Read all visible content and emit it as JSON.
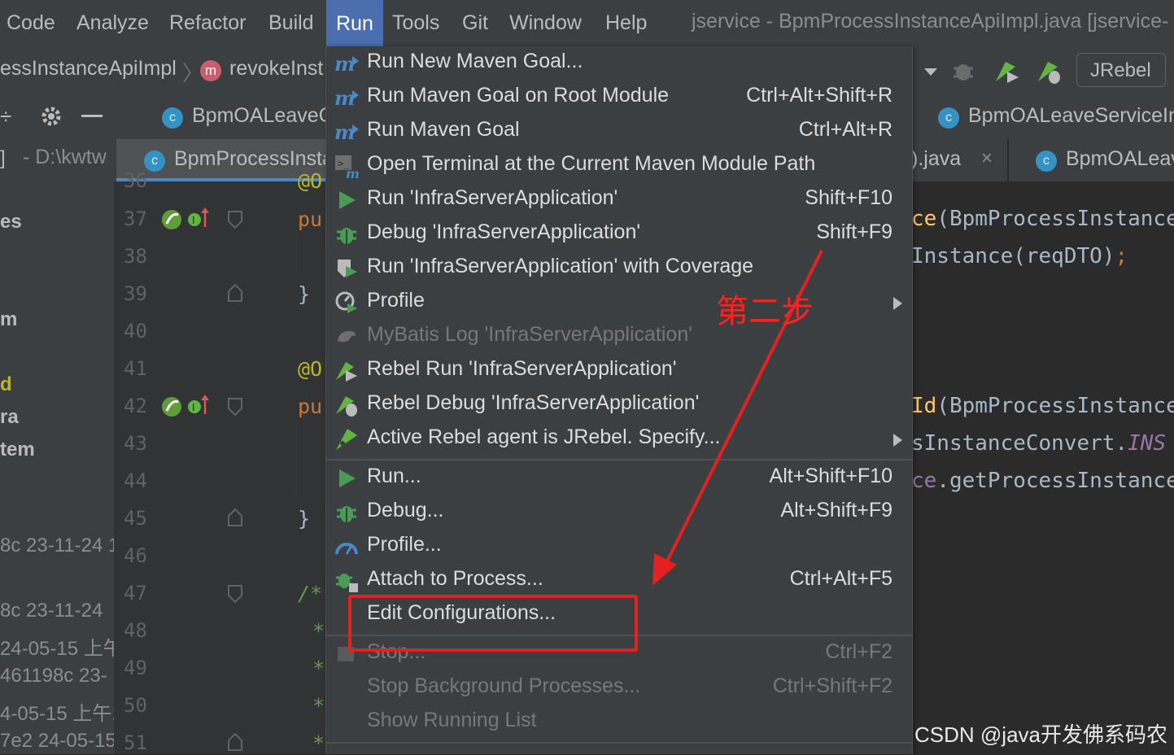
{
  "menubar": {
    "items": [
      "Code",
      "Analyze",
      "Refactor",
      "Build",
      "Run",
      "Tools",
      "Git",
      "Window",
      "Help"
    ],
    "active": "Run",
    "title": "jservice - BpmProcessInstanceApiImpl.java [jservice-"
  },
  "navbar": {
    "crumb_class": "essInstanceApiImpl",
    "crumb_method": "revokeInst",
    "method_badge": "m",
    "run_config": "JRebel"
  },
  "tabs": {
    "row1_left": "BpmOALeaveC",
    "row1_right": "BpmOALeaveServiceIn",
    "row2_path": "- D:\\kwtw",
    "row2_active": "BpmProcessInsta",
    "row2_mid": ").java",
    "row2_right": "BpmOALeav",
    "class_badge": "c"
  },
  "sidebar": {
    "lines": [
      "es",
      "m",
      "d",
      "ra",
      "tem",
      "8c 23-11-24 1",
      "8c 23-11-24",
      "24-05-15 上午",
      "461198c 23-",
      "4-05-15 上午1",
      "7e2 24-05-15"
    ]
  },
  "gutter": {
    "line_numbers": [
      "36",
      "37",
      "38",
      "39",
      "40",
      "41",
      "42",
      "43",
      "44",
      "45",
      "46",
      "47",
      "48",
      "49",
      "50",
      "51"
    ]
  },
  "code_left": {
    "l36": "@O",
    "l37": "pu",
    "l39": "}",
    "l41": "@O",
    "l42": "pu",
    "l45": "}",
    "l47": "/*",
    "l48": "*",
    "l49": "*",
    "l50": "*",
    "l51": "*"
  },
  "code_right": {
    "l37_a": "ce",
    "l37_b": "(BpmProcessInstance",
    "l38_a": "Instance(reqDTO)",
    "l38_b": ";",
    "l42_a": "Id",
    "l42_b": "(BpmProcessInstance",
    "l43_a": "sInstanceConvert.",
    "l43_b": "INS",
    "l44_a": "ce",
    "l44_b": ".getProcessInstance"
  },
  "run_menu": {
    "items": [
      {
        "label": "Run New Maven Goal...",
        "shortcut": "",
        "icon": "maven-icon"
      },
      {
        "label": "Run Maven Goal on Root Module",
        "shortcut": "Ctrl+Alt+Shift+R",
        "icon": "maven-icon"
      },
      {
        "label": "Run Maven Goal",
        "shortcut": "Ctrl+Alt+R",
        "icon": "maven-icon"
      },
      {
        "label": "Open Terminal at the Current Maven Module Path",
        "shortcut": "",
        "icon": "terminal-maven-icon"
      },
      {
        "label": "Run 'InfraServerApplication'",
        "shortcut": "Shift+F10",
        "icon": "run-icon"
      },
      {
        "label": "Debug 'InfraServerApplication'",
        "shortcut": "Shift+F9",
        "icon": "debug-icon"
      },
      {
        "label": "Run 'InfraServerApplication' with Coverage",
        "shortcut": "",
        "icon": "coverage-icon"
      },
      {
        "label": "Profile",
        "shortcut": "",
        "icon": "profile-icon"
      },
      {
        "label": "MyBatis Log 'InfraServerApplication'",
        "shortcut": "",
        "icon": "mybatis-icon"
      },
      {
        "label": "Rebel Run 'InfraServerApplication'",
        "shortcut": "",
        "icon": "rebel-run-icon"
      },
      {
        "label": "Rebel Debug 'InfraServerApplication'",
        "shortcut": "",
        "icon": "rebel-debug-icon"
      },
      {
        "label": "Active Rebel agent is JRebel. Specify...",
        "shortcut": "",
        "icon": "rebel-agent-icon"
      },
      {
        "label": "Run...",
        "shortcut": "Alt+Shift+F10",
        "icon": "run-icon"
      },
      {
        "label": "Debug...",
        "shortcut": "Alt+Shift+F9",
        "icon": "debug-icon"
      },
      {
        "label": "Profile...",
        "shortcut": "",
        "icon": "profiler-gauge-icon"
      },
      {
        "label": "Attach to Process...",
        "shortcut": "Ctrl+Alt+F5",
        "icon": "attach-icon"
      },
      {
        "label": "Edit Configurations...",
        "shortcut": "",
        "icon": ""
      },
      {
        "label": "Stop...",
        "shortcut": "Ctrl+F2",
        "icon": "stop-icon"
      },
      {
        "label": "Stop Background Processes...",
        "shortcut": "Ctrl+Shift+F2",
        "icon": ""
      },
      {
        "label": "Show Running List",
        "shortcut": "",
        "icon": ""
      }
    ]
  },
  "annotation": {
    "step_text": "第二步",
    "color": "#e42020"
  },
  "watermark": "CSDN @java开发佛系码农",
  "colors": {
    "editor_bg": "#2b2b2b",
    "menu_bg": "#3c3f41",
    "menu_active": "#4b6eaf",
    "keyword": "#cc7832",
    "annotation_yellow": "#bbb529"
  }
}
